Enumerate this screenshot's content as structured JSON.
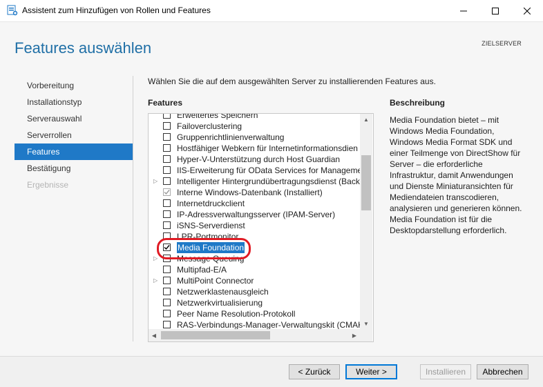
{
  "window": {
    "title": "Assistent zum Hinzufügen von Rollen und Features"
  },
  "header": {
    "page_title": "Features auswählen",
    "server_label": "ZIELSERVER"
  },
  "nav": {
    "items": [
      {
        "label": "Vorbereitung",
        "state": "normal"
      },
      {
        "label": "Installationstyp",
        "state": "normal"
      },
      {
        "label": "Serverauswahl",
        "state": "normal"
      },
      {
        "label": "Serverrollen",
        "state": "normal"
      },
      {
        "label": "Features",
        "state": "active"
      },
      {
        "label": "Bestätigung",
        "state": "normal"
      },
      {
        "label": "Ergebnisse",
        "state": "disabled"
      }
    ]
  },
  "main": {
    "intro": "Wählen Sie die auf dem ausgewählten Server zu installierenden Features aus.",
    "features_heading": "Features",
    "description_heading": "Beschreibung",
    "features": [
      {
        "label": "Erweitertes Speichern",
        "checked": false,
        "expandable": false,
        "disabled": false,
        "selected": false
      },
      {
        "label": "Failoverclustering",
        "checked": false,
        "expandable": false,
        "disabled": false,
        "selected": false
      },
      {
        "label": "Gruppenrichtlinienverwaltung",
        "checked": false,
        "expandable": false,
        "disabled": false,
        "selected": false
      },
      {
        "label": "Hostfähiger Webkern für Internetinformationsdien",
        "checked": false,
        "expandable": false,
        "disabled": false,
        "selected": false
      },
      {
        "label": "Hyper-V-Unterstützung durch Host Guardian",
        "checked": false,
        "expandable": false,
        "disabled": false,
        "selected": false
      },
      {
        "label": "IIS-Erweiterung für OData Services for Managemen",
        "checked": false,
        "expandable": false,
        "disabled": false,
        "selected": false
      },
      {
        "label": "Intelligenter Hintergrundübertragungsdienst (Back",
        "checked": false,
        "expandable": true,
        "disabled": false,
        "selected": false
      },
      {
        "label": "Interne Windows-Datenbank (Installiert)",
        "checked": true,
        "expandable": false,
        "disabled": true,
        "selected": false
      },
      {
        "label": "Internetdruckclient",
        "checked": false,
        "expandable": false,
        "disabled": false,
        "selected": false
      },
      {
        "label": "IP-Adressverwaltungsserver (IPAM-Server)",
        "checked": false,
        "expandable": false,
        "disabled": false,
        "selected": false
      },
      {
        "label": "iSNS-Serverdienst",
        "checked": false,
        "expandable": false,
        "disabled": false,
        "selected": false
      },
      {
        "label": "LPR-Portmonitor",
        "checked": false,
        "expandable": false,
        "disabled": false,
        "selected": false
      },
      {
        "label": "Media Foundation",
        "checked": true,
        "expandable": false,
        "disabled": false,
        "selected": true
      },
      {
        "label": "Message Queuing",
        "checked": false,
        "expandable": true,
        "disabled": false,
        "selected": false
      },
      {
        "label": "Multipfad-E/A",
        "checked": false,
        "expandable": false,
        "disabled": false,
        "selected": false
      },
      {
        "label": "MultiPoint Connector",
        "checked": false,
        "expandable": true,
        "disabled": false,
        "selected": false
      },
      {
        "label": "Netzwerklastenausgleich",
        "checked": false,
        "expandable": false,
        "disabled": false,
        "selected": false
      },
      {
        "label": "Netzwerkvirtualisierung",
        "checked": false,
        "expandable": false,
        "disabled": false,
        "selected": false
      },
      {
        "label": "Peer Name Resolution-Protokoll",
        "checked": false,
        "expandable": false,
        "disabled": false,
        "selected": false
      },
      {
        "label": "RAS-Verbindungs-Manager-Verwaltungskit (CMAK",
        "checked": false,
        "expandable": false,
        "disabled": false,
        "selected": false
      }
    ],
    "description": "Media Foundation bietet – mit Windows Media Foundation, Windows Media Format SDK und einer Teilmenge von DirectShow für Server – die erforderliche Infrastruktur, damit Anwendungen und Dienste Miniaturansichten für Mediendateien transcodieren, analysieren und generieren können. Media Foundation ist für die Desktopdarstellung erforderlich."
  },
  "footer": {
    "back_label": "< Zurück",
    "next_label": "Weiter >",
    "install_label": "Installieren",
    "cancel_label": "Abbrechen"
  },
  "colors": {
    "accent": "#1f79c7",
    "title_blue": "#1f6fa6",
    "highlight_ring": "#e01b24"
  }
}
